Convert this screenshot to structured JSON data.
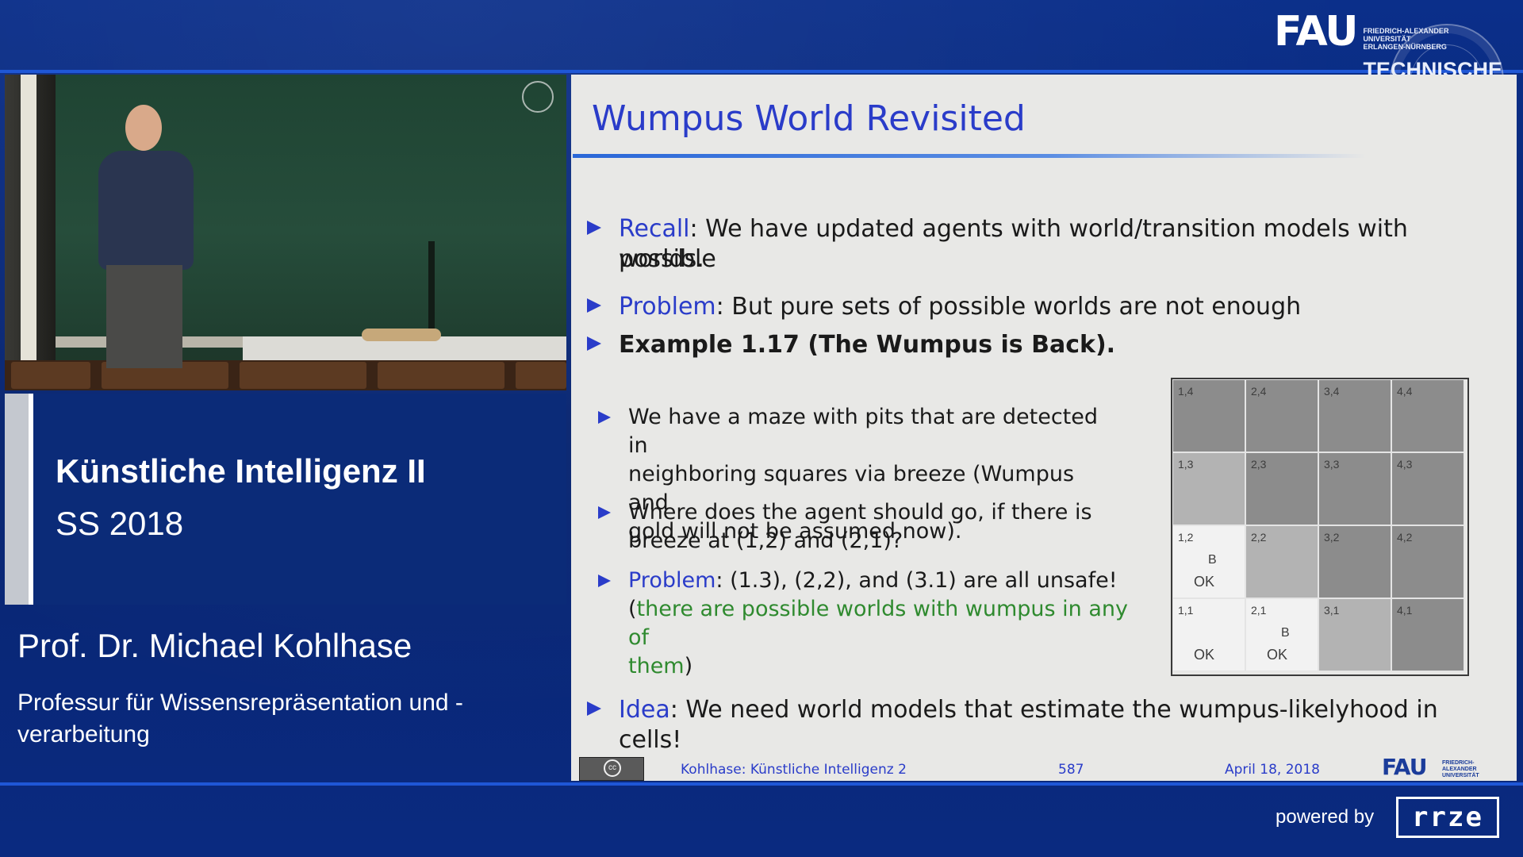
{
  "header": {
    "logo_mark": "FAU",
    "logo_lines": [
      "FRIEDRICH-ALEXANDER",
      "UNIVERSITÄT",
      "ERLANGEN-NÜRNBERG"
    ],
    "faculty": "TECHNISCHE FAKULTÄT"
  },
  "lecture": {
    "course_title": "Künstliche Intelligenz II",
    "term": "SS 2018",
    "professor": "Prof. Dr. Michael Kohlhase",
    "chair": "Professur für Wissensrepräsentation und -verarbeitung"
  },
  "slide": {
    "title": "Wumpus World Revisited",
    "bullets": {
      "recall_key": "Recall",
      "recall_rest": ": We have updated agents with world/transition models with possible",
      "recall_cont": "worlds.",
      "problem_key": "Problem",
      "problem_rest": ": But pure sets of possible worlds are not enough",
      "example": "Example 1.17 (The Wumpus is Back).",
      "sub1_l1": "We have a maze with pits that are detected in",
      "sub1_l2": "neighboring squares via breeze (Wumpus and",
      "sub1_l3": "gold will not be assumed now).",
      "sub2_l1": "Where does the agent should go, if there is",
      "sub2_l2": "breeze at (1,2) and (2,1)?",
      "sub3_key": "Problem",
      "sub3_rest": ": (1.3), (2,2), and (3.1) are all unsafe!",
      "sub3_open": "(",
      "sub3_green1": "there are possible worlds with wumpus in any of",
      "sub3_green2": "them",
      "sub3_close": ")",
      "idea_key": "Idea",
      "idea_rest": ": We need world models that estimate the wumpus-likelyhood in cells!"
    },
    "grid": {
      "cells": [
        {
          "label": "1,4",
          "shade": "#8c8c8c"
        },
        {
          "label": "2,4",
          "shade": "#8c8c8c"
        },
        {
          "label": "3,4",
          "shade": "#8c8c8c"
        },
        {
          "label": "4,4",
          "shade": "#8c8c8c"
        },
        {
          "label": "1,3",
          "shade": "#b3b3b3"
        },
        {
          "label": "2,3",
          "shade": "#8c8c8c"
        },
        {
          "label": "3,3",
          "shade": "#8c8c8c"
        },
        {
          "label": "4,3",
          "shade": "#8c8c8c"
        },
        {
          "label": "1,2",
          "shade": "#f2f2f2",
          "b": "B",
          "ok": "OK"
        },
        {
          "label": "2,2",
          "shade": "#b3b3b3"
        },
        {
          "label": "3,2",
          "shade": "#8c8c8c"
        },
        {
          "label": "4,2",
          "shade": "#8c8c8c"
        },
        {
          "label": "1,1",
          "shade": "#f2f2f2",
          "ok": "OK"
        },
        {
          "label": "2,1",
          "shade": "#f2f2f2",
          "b": "B",
          "ok": "OK"
        },
        {
          "label": "3,1",
          "shade": "#b3b3b3"
        },
        {
          "label": "4,1",
          "shade": "#8c8c8c"
        }
      ]
    },
    "footer": {
      "author_course": "Kohlhase: Künstliche Intelligenz 2",
      "page": "587",
      "date": "April 18, 2018",
      "logo_mark": "FAU",
      "logo_text": "FRIEDRICH-ALEXANDER UNIVERSITÄT"
    }
  },
  "bottom": {
    "powered_by": "powered by",
    "rrze_logo": "rrze"
  },
  "colors": {
    "background": "#0a2a86",
    "slide_accent": "#2a3cc9",
    "green_text": "#2f8a2f"
  }
}
